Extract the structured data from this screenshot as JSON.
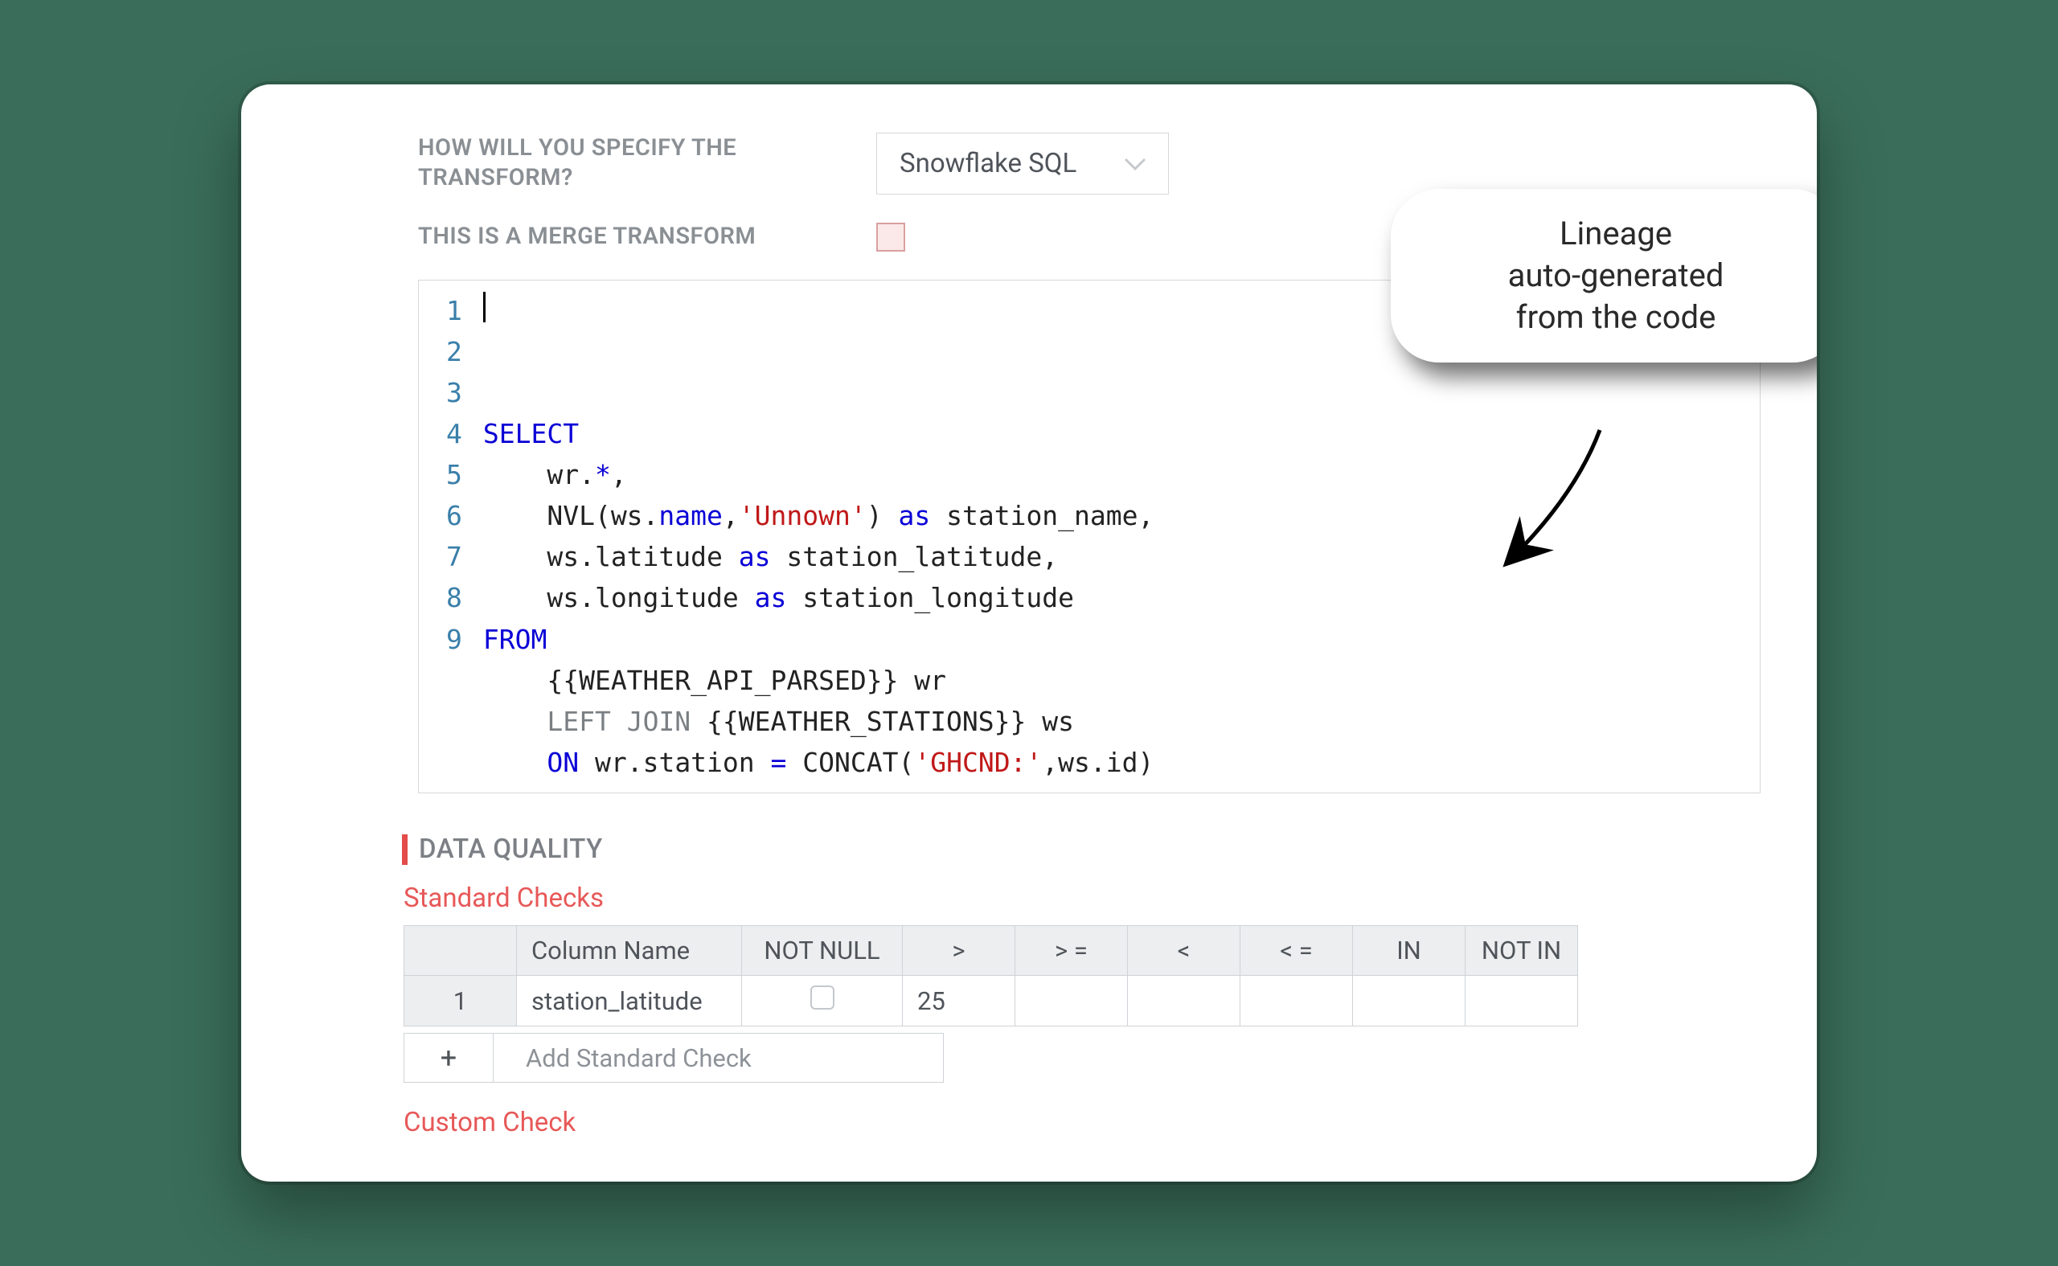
{
  "form": {
    "transform_label": "HOW WILL YOU SPECIFY THE TRANSFORM?",
    "transform_select_value": "Snowflake SQL",
    "merge_label": "THIS IS A MERGE TRANSFORM"
  },
  "code": {
    "lines": [
      [
        {
          "t": "SELECT",
          "c": "kw"
        }
      ],
      [
        {
          "t": "    wr.",
          "c": ""
        },
        {
          "t": "*",
          "c": "kw"
        },
        {
          "t": ",",
          "c": ""
        }
      ],
      [
        {
          "t": "    NVL(ws.",
          "c": ""
        },
        {
          "t": "name",
          "c": "kw"
        },
        {
          "t": ",",
          "c": ""
        },
        {
          "t": "'Unnown'",
          "c": "str"
        },
        {
          "t": ") ",
          "c": ""
        },
        {
          "t": "as",
          "c": "kw"
        },
        {
          "t": " station_name,",
          "c": ""
        }
      ],
      [
        {
          "t": "    ws.latitude ",
          "c": ""
        },
        {
          "t": "as",
          "c": "kw"
        },
        {
          "t": " station_latitude,",
          "c": ""
        }
      ],
      [
        {
          "t": "    ws.longitude ",
          "c": ""
        },
        {
          "t": "as",
          "c": "kw"
        },
        {
          "t": " station_longitude",
          "c": ""
        }
      ],
      [
        {
          "t": "FROM",
          "c": "kw"
        }
      ],
      [
        {
          "t": "    {{WEATHER_API_PARSED}} wr",
          "c": ""
        }
      ],
      [
        {
          "t": "    ",
          "c": ""
        },
        {
          "t": "LEFT JOIN",
          "c": "op"
        },
        {
          "t": " {{WEATHER_STATIONS}} ws",
          "c": ""
        }
      ],
      [
        {
          "t": "    ",
          "c": ""
        },
        {
          "t": "ON",
          "c": "kw"
        },
        {
          "t": " wr.station ",
          "c": ""
        },
        {
          "t": "=",
          "c": "kw"
        },
        {
          "t": " CONCAT(",
          "c": ""
        },
        {
          "t": "'GHCND:'",
          "c": "str"
        },
        {
          "t": ",ws.id)",
          "c": ""
        }
      ]
    ]
  },
  "data_quality": {
    "section_title": "DATA QUALITY",
    "standard_checks_title": "Standard Checks",
    "custom_check_title": "Custom Check",
    "headers": [
      "Column Name",
      "NOT NULL",
      ">",
      "> =",
      "<",
      "< =",
      "IN",
      "NOT IN"
    ],
    "rows": [
      {
        "num": "1",
        "column_name": "station_latitude",
        "not_null": false,
        "gt": "25",
        "gte": "",
        "lt": "",
        "lte": "",
        "in": "",
        "not_in": ""
      }
    ],
    "add_label": "Add Standard Check"
  },
  "callout": {
    "line1": "Lineage",
    "line2": "auto-generated",
    "line3": "from the code"
  }
}
